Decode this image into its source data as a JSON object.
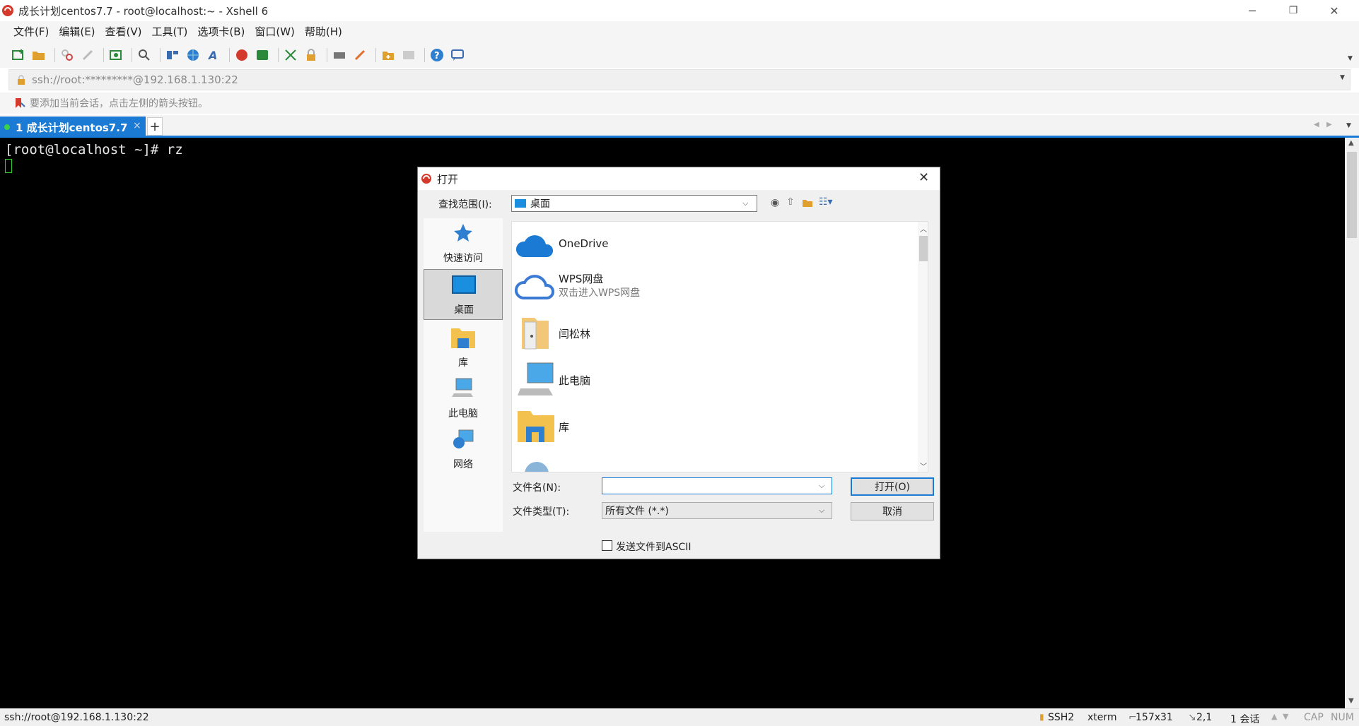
{
  "window": {
    "title": "成长计划centos7.7 - root@localhost:~ - Xshell 6",
    "controls": {
      "minimize": "─",
      "restore": "❐",
      "close": "✕"
    }
  },
  "menu": [
    "文件(F)",
    "编辑(E)",
    "查看(V)",
    "工具(T)",
    "选项卡(B)",
    "窗口(W)",
    "帮助(H)"
  ],
  "address": {
    "value": "ssh://root:*********@192.168.1.130:22"
  },
  "hint": {
    "text": "要添加当前会话，点击左侧的箭头按钮。"
  },
  "tabs": [
    {
      "label": "1 成长计划centos7.7",
      "close": "×"
    }
  ],
  "new_tab": "+",
  "terminal": {
    "line1": "[root@localhost ~]# rz"
  },
  "dialog": {
    "title": "打开",
    "look_in_label": "查找范围(I):",
    "look_in_value": "桌面",
    "places": [
      {
        "label": "快速访问",
        "icon": "star-icon"
      },
      {
        "label": "桌面",
        "icon": "desktop-icon"
      },
      {
        "label": "库",
        "icon": "library-folder-icon"
      },
      {
        "label": "此电脑",
        "icon": "computer-icon"
      },
      {
        "label": "网络",
        "icon": "network-icon"
      }
    ],
    "files": [
      {
        "name": "OneDrive",
        "sub": "",
        "icon": "onedrive-cloud-icon"
      },
      {
        "name": "WPS网盘",
        "sub": "双击进入WPS网盘",
        "icon": "wps-cloud-icon"
      },
      {
        "name": "闫松林",
        "sub": "",
        "icon": "user-folder-icon"
      },
      {
        "name": "此电脑",
        "sub": "",
        "icon": "computer-icon"
      },
      {
        "name": "库",
        "sub": "",
        "icon": "library-folder-icon"
      }
    ],
    "filename_label": "文件名(N):",
    "filename_value": "",
    "filetype_label": "文件类型(T):",
    "filetype_value": "所有文件 (*.*)",
    "open_button": "打开(O)",
    "cancel_button": "取消",
    "ascii_label": "发送文件到ASCII",
    "ascii_checked": false
  },
  "status": {
    "connection": "ssh://root@192.168.1.130:22",
    "protocol": "SSH2",
    "terminal_type": "xterm",
    "size": "157x31",
    "cursor": "2,1",
    "sessions": "1 会话",
    "caps": "CAP",
    "num": "NUM"
  },
  "colors": {
    "accent": "#1a7ad4",
    "terminal_bg": "#000000",
    "terminal_fg": "#e8e8e8"
  }
}
